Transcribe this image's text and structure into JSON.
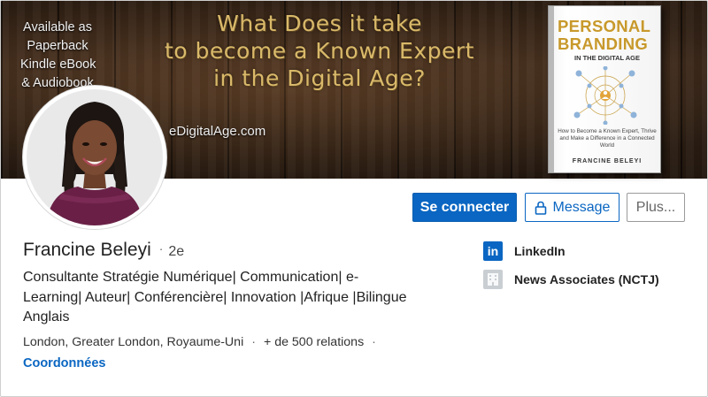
{
  "banner": {
    "available_lines": [
      "Available as",
      "Paperback",
      "Kindle eBook",
      "& Audiobook"
    ],
    "headline_lines": [
      "What Does it take",
      "to become a Known Expert",
      "in the Digital Age?"
    ],
    "url_text": "eDigitalAge.com",
    "book": {
      "title_line1": "PERSONAL",
      "title_line2": "BRANDING",
      "subtitle": "IN THE DIGITAL AGE",
      "blurb": "How to Become a Known Expert, Thrive and Make a Difference in a Connected World",
      "author": "FRANCINE BELEYI"
    }
  },
  "actions": {
    "connect_label": "Se connecter",
    "message_label": "Message",
    "more_label": "Plus..."
  },
  "profile": {
    "name": "Francine Beleyi",
    "separator": "·",
    "degree": "2e",
    "headline_lines": [
      "Consultante Stratégie Numérique| Communication| e-",
      "Learning| Auteur| Conférencière| Innovation |Afrique |Bilingue",
      "Anglais"
    ],
    "location": "London, Greater London, Royaume-Uni",
    "connections": "+ de 500 relations",
    "contact_label": "Coordonnées"
  },
  "experience": [
    {
      "name": "LinkedIn",
      "icon": "linkedin-logo-icon"
    },
    {
      "name": "News Associates (NCTJ)",
      "icon": "building-icon"
    }
  ],
  "colors": {
    "primary": "#0a66c2",
    "banner_text_gold": "#d9b96a",
    "book_title": "#c8992b"
  }
}
